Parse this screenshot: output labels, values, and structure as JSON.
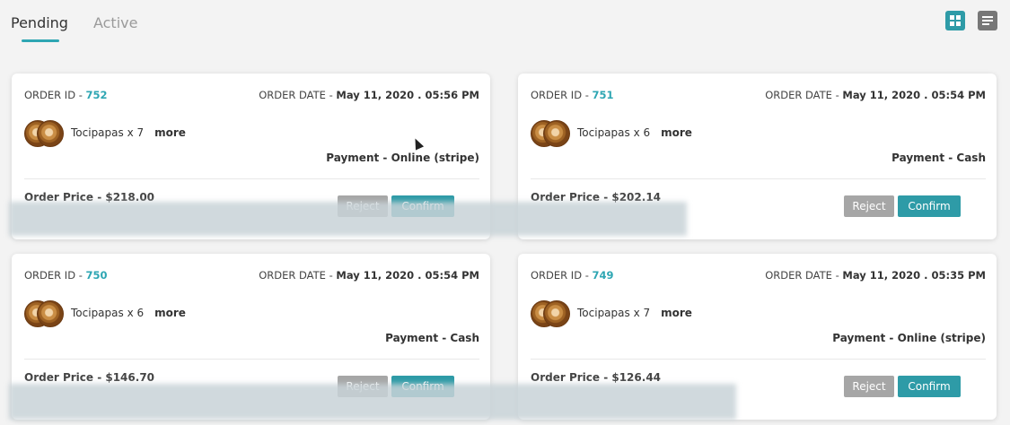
{
  "tabs": [
    {
      "label": "Pending",
      "active": true
    },
    {
      "label": "Active",
      "active": false
    }
  ],
  "view_toggle": {
    "grid_icon": "grid-view-icon",
    "list_icon": "list-view-icon",
    "accent": "#2e9ba7"
  },
  "labels": {
    "order_id": "ORDER ID - ",
    "order_date": "ORDER DATE - ",
    "payment": "Payment - ",
    "order_price": "Order Price - ",
    "more": "more",
    "reject": "Reject",
    "confirm": "Confirm"
  },
  "orders": [
    {
      "id": "752",
      "date": "May 11, 2020 . 05:56 PM",
      "item": "Tocipapas x 7",
      "payment": "Online (stripe)",
      "price": "$218.00"
    },
    {
      "id": "751",
      "date": "May 11, 2020 . 05:54 PM",
      "item": "Tocipapas x 6",
      "payment": "Cash",
      "price": "$202.14"
    },
    {
      "id": "750",
      "date": "May 11, 2020 . 05:54 PM",
      "item": "Tocipapas x 6",
      "payment": "Cash",
      "price": "$146.70"
    },
    {
      "id": "749",
      "date": "May 11, 2020 . 05:35 PM",
      "item": "Tocipapas x 7",
      "payment": "Online (stripe)",
      "price": "$126.44"
    }
  ]
}
